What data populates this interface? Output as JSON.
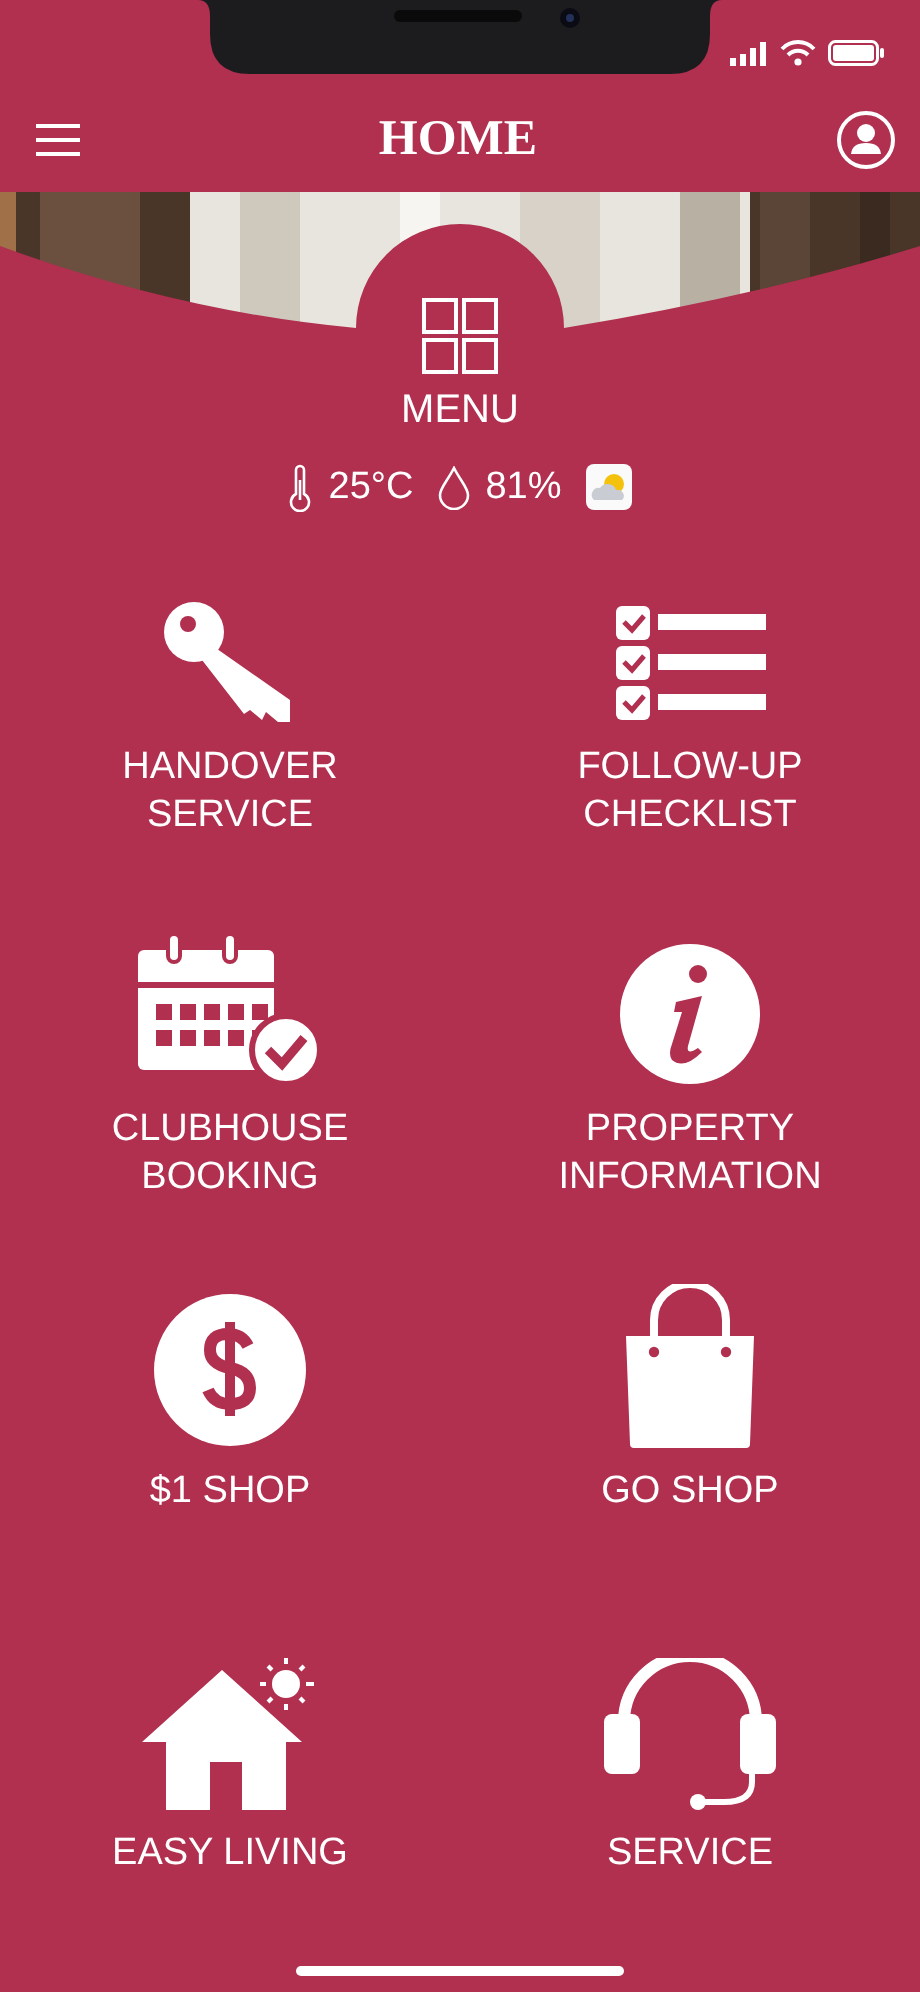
{
  "header": {
    "title": "HOME"
  },
  "menu": {
    "label": "MENU"
  },
  "weather": {
    "temperature": "25°C",
    "humidity": "81%"
  },
  "tiles": [
    {
      "kind": "key",
      "label": "HANDOVER\nSERVICE"
    },
    {
      "kind": "checklist",
      "label": "FOLLOW-UP\nCHECKLIST"
    },
    {
      "kind": "calendar",
      "label": "CLUBHOUSE\nBOOKING"
    },
    {
      "kind": "info",
      "label": "PROPERTY\nINFORMATION"
    },
    {
      "kind": "dollar",
      "label": "$1 SHOP"
    },
    {
      "kind": "bag",
      "label": "GO SHOP"
    },
    {
      "kind": "house",
      "label": "EASY LIVING"
    },
    {
      "kind": "headset",
      "label": "SERVICE"
    }
  ]
}
